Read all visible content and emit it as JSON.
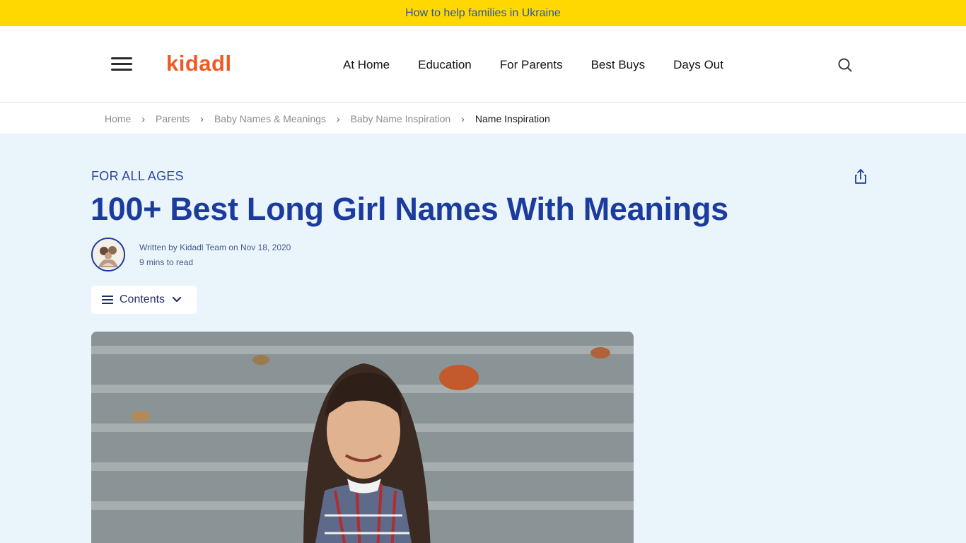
{
  "banner": {
    "text": "How to help families in Ukraine"
  },
  "header": {
    "logo": "kidadl",
    "nav": [
      "At Home",
      "Education",
      "For Parents",
      "Best Buys",
      "Days Out"
    ]
  },
  "breadcrumb": [
    "Home",
    "Parents",
    "Baby Names & Meanings",
    "Baby Name Inspiration",
    "Name Inspiration"
  ],
  "article": {
    "kicker": "FOR ALL AGES",
    "title": "100+ Best Long Girl Names With Meanings",
    "byline": "Written by Kidadl Team on Nov 18, 2020",
    "read_time": "9 mins to read",
    "contents_label": "Contents"
  },
  "colors": {
    "banner_bg": "#fed800",
    "brand_orange": "#ef5a24",
    "title_blue": "#1b3c9e",
    "page_bg": "#eaf4fb"
  },
  "icons": [
    "menu-icon",
    "search-icon",
    "share-icon",
    "list-icon",
    "chevron-down-icon"
  ]
}
